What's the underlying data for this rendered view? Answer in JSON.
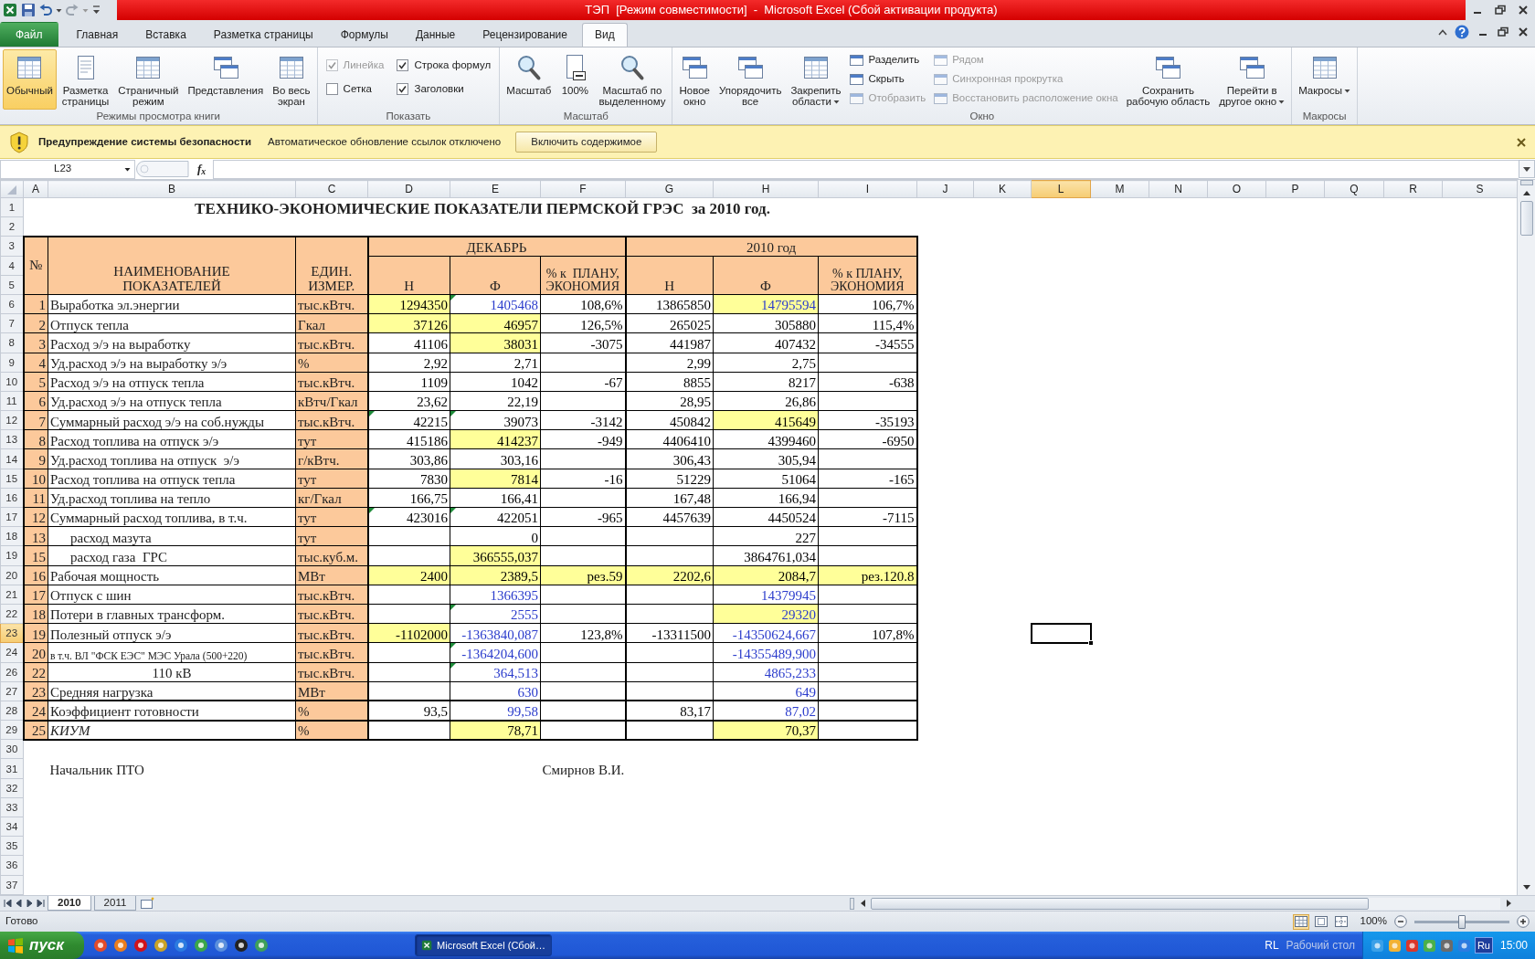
{
  "window": {
    "title": "ТЭП  [Режим совместимости]  -  Microsoft Excel (Сбой активации продукта)"
  },
  "ribbon": {
    "tabs": [
      {
        "label": "Файл",
        "kind": "file",
        "selected": false
      },
      {
        "label": "Главная",
        "kind": "tab",
        "selected": false
      },
      {
        "label": "Вставка",
        "kind": "tab",
        "selected": false
      },
      {
        "label": "Разметка страницы",
        "kind": "tab",
        "selected": false
      },
      {
        "label": "Формулы",
        "kind": "tab",
        "selected": false
      },
      {
        "label": "Данные",
        "kind": "tab",
        "selected": false
      },
      {
        "label": "Рецензирование",
        "kind": "tab",
        "selected": false
      },
      {
        "label": "Вид",
        "kind": "tab",
        "selected": true
      }
    ],
    "groups": [
      {
        "label": "Режимы просмотра книги",
        "controls": [
          {
            "kind": "large",
            "label": "Обычный",
            "selected": true,
            "disabled": false,
            "dropdown": false
          },
          {
            "kind": "large",
            "label": "Разметка\nстраницы",
            "selected": false,
            "disabled": false,
            "dropdown": false
          },
          {
            "kind": "large",
            "label": "Страничный\nрежим",
            "selected": false,
            "disabled": false,
            "dropdown": false
          },
          {
            "kind": "large",
            "label": "Представления",
            "selected": false,
            "disabled": false,
            "dropdown": false
          },
          {
            "kind": "large",
            "label": "Во весь\nэкран",
            "selected": false,
            "disabled": false,
            "dropdown": false
          }
        ]
      },
      {
        "label": "Показать",
        "controls": [
          {
            "kind": "checkbox",
            "label": "Линейка",
            "checked": true,
            "disabled": true
          },
          {
            "kind": "checkbox",
            "label": "Строка формул",
            "checked": true,
            "disabled": false
          },
          {
            "kind": "checkbox",
            "label": "Сетка",
            "checked": false,
            "disabled": false
          },
          {
            "kind": "checkbox",
            "label": "Заголовки",
            "checked": true,
            "disabled": false
          }
        ]
      },
      {
        "label": "Масштаб",
        "controls": [
          {
            "kind": "large",
            "label": "Масштаб",
            "selected": false,
            "disabled": false,
            "dropdown": false
          },
          {
            "kind": "large",
            "label": "100%",
            "selected": false,
            "disabled": false,
            "dropdown": false
          },
          {
            "kind": "large",
            "label": "Масштаб по\nвыделенному",
            "selected": false,
            "disabled": false,
            "dropdown": false
          }
        ]
      },
      {
        "label": "Окно",
        "controls": [
          {
            "kind": "large",
            "label": "Новое\nокно",
            "selected": false,
            "disabled": false,
            "dropdown": false
          },
          {
            "kind": "large",
            "label": "Упорядочить\nвсе",
            "selected": false,
            "disabled": false,
            "dropdown": false
          },
          {
            "kind": "large",
            "label": "Закрепить\nобласти",
            "selected": false,
            "disabled": false,
            "dropdown": true
          },
          {
            "kind": "small",
            "label": "Разделить",
            "disabled": false
          },
          {
            "kind": "small",
            "label": "Скрыть",
            "disabled": false
          },
          {
            "kind": "small",
            "label": "Отобразить",
            "disabled": true
          },
          {
            "kind": "small",
            "label": "Рядом",
            "disabled": true
          },
          {
            "kind": "small",
            "label": "Синхронная прокрутка",
            "disabled": true
          },
          {
            "kind": "small",
            "label": "Восстановить расположение окна",
            "disabled": true
          },
          {
            "kind": "large",
            "label": "Сохранить\nрабочую область",
            "selected": false,
            "disabled": false,
            "dropdown": false
          },
          {
            "kind": "large",
            "label": "Перейти в\nдругое окно",
            "selected": false,
            "disabled": false,
            "dropdown": true
          }
        ]
      },
      {
        "label": "Макросы",
        "controls": [
          {
            "kind": "large",
            "label": "Макросы",
            "selected": false,
            "disabled": false,
            "dropdown": true
          }
        ]
      }
    ]
  },
  "security_bar": {
    "title": "Предупреждение системы безопасности",
    "message": "Автоматическое обновление ссылок отключено",
    "button": "Включить содержимое"
  },
  "formula_bar": {
    "name_box": "L23",
    "function_label": "f$_{x}$"
  },
  "sheet": {
    "columns": [
      {
        "label": "A",
        "selected": false
      },
      {
        "label": "B",
        "selected": false
      },
      {
        "label": "C",
        "selected": false
      },
      {
        "label": "D",
        "selected": false
      },
      {
        "label": "E",
        "selected": false
      },
      {
        "label": "F",
        "selected": false
      },
      {
        "label": "G",
        "selected": false
      },
      {
        "label": "H",
        "selected": false
      },
      {
        "label": "I",
        "selected": false
      },
      {
        "label": "J",
        "selected": false
      },
      {
        "label": "K",
        "selected": false
      },
      {
        "label": "L",
        "selected": true
      },
      {
        "label": "M",
        "selected": false
      },
      {
        "label": "N",
        "selected": false
      },
      {
        "label": "O",
        "selected": false
      },
      {
        "label": "P",
        "selected": false
      },
      {
        "label": "Q",
        "selected": false
      },
      {
        "label": "R",
        "selected": false
      },
      {
        "label": "S",
        "selected": false
      }
    ],
    "rows": [
      {
        "label": "1",
        "selected": false
      },
      {
        "label": "2",
        "selected": false
      },
      {
        "label": "3",
        "selected": false
      },
      {
        "label": "4",
        "selected": false
      },
      {
        "label": "5",
        "selected": false
      },
      {
        "label": "6",
        "selected": false
      },
      {
        "label": "7",
        "selected": false
      },
      {
        "label": "8",
        "selected": false
      },
      {
        "label": "9",
        "selected": false
      },
      {
        "label": "10",
        "selected": false
      },
      {
        "label": "11",
        "selected": false
      },
      {
        "label": "12",
        "selected": false
      },
      {
        "label": "13",
        "selected": false
      },
      {
        "label": "14",
        "selected": false
      },
      {
        "label": "15",
        "selected": false
      },
      {
        "label": "16",
        "selected": false
      },
      {
        "label": "17",
        "selected": false
      },
      {
        "label": "18",
        "selected": false
      },
      {
        "label": "19",
        "selected": false
      },
      {
        "label": "20",
        "selected": false
      },
      {
        "label": "21",
        "selected": false
      },
      {
        "label": "22",
        "selected": false
      },
      {
        "label": "23",
        "selected": true
      },
      {
        "label": "24",
        "selected": false
      },
      {
        "label": "26",
        "selected": false
      },
      {
        "label": "27",
        "selected": false
      },
      {
        "label": "28",
        "selected": false
      },
      {
        "label": "29",
        "selected": false
      },
      {
        "label": "30",
        "selected": false
      },
      {
        "label": "31",
        "selected": false
      },
      {
        "label": "32",
        "selected": false
      },
      {
        "label": "33",
        "selected": false
      },
      {
        "label": "34",
        "selected": false
      },
      {
        "label": "35",
        "selected": false
      },
      {
        "label": "36",
        "selected": false
      },
      {
        "label": "37",
        "selected": false
      }
    ]
  },
  "table": {
    "title": "ТЕХНИКО-ЭКОНОМИЧЕСКИЕ ПОКАЗАТЕЛИ ПЕРМСКОЙ ГРЭС  за 2010 год.",
    "header": {
      "number": "№",
      "name": "НАИМЕНОВАНИЕ\nПОКАЗАТЕЛЕЙ",
      "unit": "ЕДИН.\nИЗМЕР.",
      "periods": [
        {
          "label": "ДЕКАБРЬ",
          "columns": [
            "Н",
            "Ф",
            "% к  ПЛАНУ,\nЭКОНОМИЯ"
          ]
        },
        {
          "label": "2010 год",
          "columns": [
            "Н",
            "Ф",
            "% к ПЛАНУ,\nЭКОНОМИЯ"
          ]
        }
      ]
    },
    "rows": [
      {
        "number": "1",
        "name": "Выработка эл.энергии",
        "kind": "plain",
        "unit": "тыс.кВтч.",
        "values": {
          "december_plan": {
            "text": "1294350",
            "highlighted": true,
            "color": "#000000",
            "flagged": false
          },
          "december_fact": {
            "text": "1405468",
            "highlighted": false,
            "color": "#2b3ccc",
            "flagged": true
          },
          "december_percent": {
            "text": "108,6%",
            "highlighted": false,
            "color": "#000000",
            "flagged": false
          },
          "year_plan": {
            "text": "13865850",
            "highlighted": false,
            "color": "#000000",
            "flagged": false
          },
          "year_fact": {
            "text": "14795594",
            "highlighted": true,
            "color": "#2b3ccc",
            "flagged": false
          },
          "year_percent": {
            "text": "106,7%",
            "highlighted": false,
            "color": "#000000",
            "flagged": false
          }
        }
      },
      {
        "number": "2",
        "name": "Отпуск тепла",
        "kind": "plain",
        "unit": "Гкал",
        "values": {
          "december_plan": {
            "text": "37126",
            "highlighted": true,
            "color": "#000000",
            "flagged": false
          },
          "december_fact": {
            "text": "46957",
            "highlighted": true,
            "color": "#000000",
            "flagged": false
          },
          "december_percent": {
            "text": "126,5%",
            "highlighted": false,
            "color": "#000000",
            "flagged": false
          },
          "year_plan": {
            "text": "265025",
            "highlighted": false,
            "color": "#000000",
            "flagged": false
          },
          "year_fact": {
            "text": "305880",
            "highlighted": false,
            "color": "#000000",
            "flagged": false
          },
          "year_percent": {
            "text": "115,4%",
            "highlighted": false,
            "color": "#000000",
            "flagged": false
          }
        }
      },
      {
        "number": "3",
        "name": "Расход э/э на выработку",
        "kind": "plain",
        "unit": "тыс.кВтч.",
        "values": {
          "december_plan": {
            "text": "41106",
            "highlighted": false,
            "color": "#000000",
            "flagged": false
          },
          "december_fact": {
            "text": "38031",
            "highlighted": true,
            "color": "#000000",
            "flagged": false
          },
          "december_percent": {
            "text": "-3075",
            "highlighted": false,
            "color": "#000000",
            "flagged": false
          },
          "year_plan": {
            "text": "441987",
            "highlighted": false,
            "color": "#000000",
            "flagged": false
          },
          "year_fact": {
            "text": "407432",
            "highlighted": false,
            "color": "#000000",
            "flagged": false
          },
          "year_percent": {
            "text": "-34555",
            "highlighted": false,
            "color": "#000000",
            "flagged": false
          }
        }
      },
      {
        "number": "4",
        "name": "Уд.расход э/э на выработку э/э",
        "kind": "plain",
        "unit": "%",
        "values": {
          "december_plan": {
            "text": "2,92",
            "highlighted": false,
            "color": "#000000",
            "flagged": false
          },
          "december_fact": {
            "text": "2,71",
            "highlighted": false,
            "color": "#000000",
            "flagged": false
          },
          "year_plan": {
            "text": "2,99",
            "highlighted": false,
            "color": "#000000",
            "flagged": false
          },
          "year_fact": {
            "text": "2,75",
            "highlighted": false,
            "color": "#000000",
            "flagged": false
          }
        }
      },
      {
        "number": "5",
        "name": "Расход э/э на отпуск тепла",
        "kind": "plain",
        "unit": "тыс.кВтч.",
        "values": {
          "december_plan": {
            "text": "1109",
            "highlighted": false,
            "color": "#000000",
            "flagged": false
          },
          "december_fact": {
            "text": "1042",
            "highlighted": false,
            "color": "#000000",
            "flagged": false
          },
          "december_percent": {
            "text": "-67",
            "highlighted": false,
            "color": "#000000",
            "flagged": false
          },
          "year_plan": {
            "text": "8855",
            "highlighted": false,
            "color": "#000000",
            "flagged": false
          },
          "year_fact": {
            "text": "8217",
            "highlighted": false,
            "color": "#000000",
            "flagged": false
          },
          "year_percent": {
            "text": "-638",
            "highlighted": false,
            "color": "#000000",
            "flagged": false
          }
        }
      },
      {
        "number": "6",
        "name": "Уд.расход э/э на отпуск тепла",
        "kind": "plain",
        "unit": "кВтч/Гкал",
        "values": {
          "december_plan": {
            "text": "23,62",
            "highlighted": false,
            "color": "#000000",
            "flagged": false
          },
          "december_fact": {
            "text": "22,19",
            "highlighted": false,
            "color": "#000000",
            "flagged": false
          },
          "year_plan": {
            "text": "28,95",
            "highlighted": false,
            "color": "#000000",
            "flagged": false
          },
          "year_fact": {
            "text": "26,86",
            "highlighted": false,
            "color": "#000000",
            "flagged": false
          }
        }
      },
      {
        "number": "7",
        "name": "Суммарный расход э/э на соб.нужды",
        "kind": "plain",
        "unit": "тыс.кВтч.",
        "values": {
          "december_plan": {
            "text": "42215",
            "highlighted": false,
            "color": "#000000",
            "flagged": true
          },
          "december_fact": {
            "text": "39073",
            "highlighted": false,
            "color": "#000000",
            "flagged": true
          },
          "december_percent": {
            "text": "-3142",
            "highlighted": false,
            "color": "#000000",
            "flagged": false
          },
          "year_plan": {
            "text": "450842",
            "highlighted": false,
            "color": "#000000",
            "flagged": false
          },
          "year_fact": {
            "text": "415649",
            "highlighted": true,
            "color": "#000000",
            "flagged": false
          },
          "year_percent": {
            "text": "-35193",
            "highlighted": false,
            "color": "#000000",
            "flagged": false
          }
        }
      },
      {
        "number": "8",
        "name": "Расход топлива на отпуск э/э",
        "kind": "plain",
        "unit": "тут",
        "values": {
          "december_plan": {
            "text": "415186",
            "highlighted": false,
            "color": "#000000",
            "flagged": false
          },
          "december_fact": {
            "text": "414237",
            "highlighted": true,
            "color": "#000000",
            "flagged": false
          },
          "december_percent": {
            "text": "-949",
            "highlighted": false,
            "color": "#000000",
            "flagged": false
          },
          "year_plan": {
            "text": "4406410",
            "highlighted": false,
            "color": "#000000",
            "flagged": false
          },
          "year_fact": {
            "text": "4399460",
            "highlighted": false,
            "color": "#000000",
            "flagged": false
          },
          "year_percent": {
            "text": "-6950",
            "highlighted": false,
            "color": "#000000",
            "flagged": false
          }
        }
      },
      {
        "number": "9",
        "name": "Уд.расход топлива на отпуск  э/э",
        "kind": "plain",
        "unit": "г/кВтч.",
        "values": {
          "december_plan": {
            "text": "303,86",
            "highlighted": false,
            "color": "#000000",
            "flagged": false
          },
          "december_fact": {
            "text": "303,16",
            "highlighted": false,
            "color": "#000000",
            "flagged": false
          },
          "year_plan": {
            "text": "306,43",
            "highlighted": false,
            "color": "#000000",
            "flagged": false
          },
          "year_fact": {
            "text": "305,94",
            "highlighted": false,
            "color": "#000000",
            "flagged": false
          }
        }
      },
      {
        "number": "10",
        "name": "Расход топлива на отпуск тепла",
        "kind": "plain",
        "unit": "тут",
        "values": {
          "december_plan": {
            "text": "7830",
            "highlighted": false,
            "color": "#000000",
            "flagged": false
          },
          "december_fact": {
            "text": "7814",
            "highlighted": true,
            "color": "#000000",
            "flagged": false
          },
          "december_percent": {
            "text": "-16",
            "highlighted": false,
            "color": "#000000",
            "flagged": false
          },
          "year_plan": {
            "text": "51229",
            "highlighted": false,
            "color": "#000000",
            "flagged": false
          },
          "year_fact": {
            "text": "51064",
            "highlighted": false,
            "color": "#000000",
            "flagged": false
          },
          "year_percent": {
            "text": "-165",
            "highlighted": false,
            "color": "#000000",
            "flagged": false
          }
        }
      },
      {
        "number": "11",
        "name": "Уд.расход топлива на тепло",
        "kind": "plain",
        "unit": "кг/Гкал",
        "values": {
          "december_plan": {
            "text": "166,75",
            "highlighted": false,
            "color": "#000000",
            "flagged": false
          },
          "december_fact": {
            "text": "166,41",
            "highlighted": false,
            "color": "#000000",
            "flagged": false
          },
          "year_plan": {
            "text": "167,48",
            "highlighted": false,
            "color": "#000000",
            "flagged": false
          },
          "year_fact": {
            "text": "166,94",
            "highlighted": false,
            "color": "#000000",
            "flagged": false
          }
        }
      },
      {
        "number": "12",
        "name": "Суммарный расход топлива, в т.ч.",
        "kind": "plain",
        "unit": "тут",
        "values": {
          "december_plan": {
            "text": "423016",
            "highlighted": false,
            "color": "#000000",
            "flagged": true
          },
          "december_fact": {
            "text": "422051",
            "highlighted": false,
            "color": "#000000",
            "flagged": true
          },
          "december_percent": {
            "text": "-965",
            "highlighted": false,
            "color": "#000000",
            "flagged": false
          },
          "year_plan": {
            "text": "4457639",
            "highlighted": false,
            "color": "#000000",
            "flagged": false
          },
          "year_fact": {
            "text": "4450524",
            "highlighted": false,
            "color": "#000000",
            "flagged": false
          },
          "year_percent": {
            "text": "-7115",
            "highlighted": false,
            "color": "#000000",
            "flagged": false
          }
        }
      },
      {
        "number": "13",
        "name": "расход мазута",
        "kind": "indented",
        "unit": "тут",
        "values": {
          "december_fact": {
            "text": "0",
            "highlighted": false,
            "color": "#000000",
            "flagged": false
          },
          "year_fact": {
            "text": "227",
            "highlighted": false,
            "color": "#000000",
            "flagged": false
          }
        }
      },
      {
        "number": "15",
        "name": "расход газа  ГРС",
        "kind": "indented",
        "unit": "тыс.куб.м.",
        "values": {
          "december_fact": {
            "text": "366555,037",
            "highlighted": true,
            "color": "#000000",
            "flagged": false
          },
          "year_fact": {
            "text": "3864761,034",
            "highlighted": false,
            "color": "#000000",
            "flagged": false
          }
        }
      },
      {
        "number": "16",
        "name": "Рабочая мощность",
        "kind": "plain",
        "unit": "МВт",
        "values": {
          "december_plan": {
            "text": "2400",
            "highlighted": true,
            "color": "#000000",
            "flagged": false
          },
          "december_fact": {
            "text": "2389,5",
            "highlighted": true,
            "color": "#000000",
            "flagged": false
          },
          "december_percent": {
            "text": "рез.59",
            "highlighted": true,
            "color": "#000000",
            "flagged": false
          },
          "year_plan": {
            "text": "2202,6",
            "highlighted": true,
            "color": "#000000",
            "flagged": false
          },
          "year_fact": {
            "text": "2084,7",
            "highlighted": true,
            "color": "#000000",
            "flagged": false
          },
          "year_percent": {
            "text": "рез.120.8",
            "highlighted": true,
            "color": "#000000",
            "flagged": false
          }
        }
      },
      {
        "number": "17",
        "name": "Отпуск с шин",
        "kind": "plain",
        "unit": "тыс.кВтч.",
        "values": {
          "december_fact": {
            "text": "1366395",
            "highlighted": false,
            "color": "#2b3ccc",
            "flagged": false
          },
          "year_fact": {
            "text": "14379945",
            "highlighted": false,
            "color": "#2b3ccc",
            "flagged": false
          }
        }
      },
      {
        "number": "18",
        "name": "Потери в главных трансформ.",
        "kind": "plain",
        "unit": "тыс.кВтч.",
        "values": {
          "december_fact": {
            "text": "2555",
            "highlighted": false,
            "color": "#2b3ccc",
            "flagged": true
          },
          "year_fact": {
            "text": "29320",
            "highlighted": true,
            "color": "#2b3ccc",
            "flagged": false
          }
        }
      },
      {
        "number": "19",
        "name": "Полезный отпуск э/э",
        "kind": "plain",
        "unit": "тыс.кВтч.",
        "values": {
          "december_plan": {
            "text": "-1102000",
            "highlighted": true,
            "color": "#000000",
            "flagged": false
          },
          "december_fact": {
            "text": "-1363840,087",
            "highlighted": false,
            "color": "#2b3ccc",
            "flagged": false
          },
          "december_percent": {
            "text": "123,8%",
            "highlighted": false,
            "color": "#000000",
            "flagged": false
          },
          "year_plan": {
            "text": "-13311500",
            "highlighted": false,
            "color": "#000000",
            "flagged": false
          },
          "year_fact": {
            "text": "-14350624,667",
            "highlighted": false,
            "color": "#2b3ccc",
            "flagged": false
          },
          "year_percent": {
            "text": "107,8%",
            "highlighted": false,
            "color": "#000000",
            "flagged": false
          }
        }
      },
      {
        "number": "20",
        "name": "в т.ч. ВЛ \"ФСК ЕЭС\" МЭС Урала (500+220)",
        "kind": "small",
        "unit": "тыс.кВтч.",
        "values": {
          "december_fact": {
            "text": "-1364204,600",
            "highlighted": false,
            "color": "#2b3ccc",
            "flagged": true
          },
          "year_fact": {
            "text": "-14355489,900",
            "highlighted": false,
            "color": "#2b3ccc",
            "flagged": false
          }
        }
      },
      {
        "number": "22",
        "name": "110 кВ",
        "kind": "centered",
        "unit": "тыс.кВтч.",
        "values": {
          "december_fact": {
            "text": "364,513",
            "highlighted": false,
            "color": "#2b3ccc",
            "flagged": true
          },
          "year_fact": {
            "text": "4865,233",
            "highlighted": false,
            "color": "#2b3ccc",
            "flagged": false
          }
        }
      },
      {
        "number": "23",
        "name": "Средняя нагрузка",
        "kind": "plain",
        "unit": "МВт",
        "values": {
          "december_fact": {
            "text": "630",
            "highlighted": false,
            "color": "#2b3ccc",
            "flagged": false
          },
          "year_fact": {
            "text": "649",
            "highlighted": false,
            "color": "#2b3ccc",
            "flagged": false
          }
        }
      },
      {
        "number": "24",
        "name": "Коэффициент готовности",
        "kind": "plain",
        "unit": "%",
        "values": {
          "december_plan": {
            "text": "93,5",
            "highlighted": false,
            "color": "#000000",
            "flagged": false
          },
          "december_fact": {
            "text": "99,58",
            "highlighted": false,
            "color": "#2b3ccc",
            "flagged": false
          },
          "year_plan": {
            "text": "83,17",
            "highlighted": false,
            "color": "#000000",
            "flagged": false
          },
          "year_fact": {
            "text": "87,02",
            "highlighted": false,
            "color": "#2b3ccc",
            "flagged": false
          }
        }
      },
      {
        "number": "25",
        "name": "КИУМ",
        "kind": "italic",
        "unit": "%",
        "values": {
          "december_fact": {
            "text": "78,71",
            "highlighted": true,
            "color": "#000000",
            "flagged": false
          },
          "year_fact": {
            "text": "70,37",
            "highlighted": true,
            "color": "#000000",
            "flagged": false
          }
        }
      }
    ]
  },
  "signature": {
    "position": "Начальник ПТО",
    "person": "Смирнов В.И."
  },
  "sheet_tabs": [
    {
      "label": "2010",
      "selected": true
    },
    {
      "label": "2011",
      "selected": false
    }
  ],
  "status_bar": {
    "text": "Готово",
    "views": [
      {
        "selected": true
      },
      {
        "selected": false
      },
      {
        "selected": false
      }
    ],
    "zoom": "100%",
    "zoom_slider": {
      "level": 0.5
    }
  },
  "taskbar": {
    "start": "пуск",
    "tasks": [
      {
        "label": "Microsoft Excel (Сбой…",
        "selected": true
      }
    ],
    "language": "RL",
    "desktop": "Рабочий стол",
    "input_language": "Ru",
    "clock": "15:00"
  }
}
